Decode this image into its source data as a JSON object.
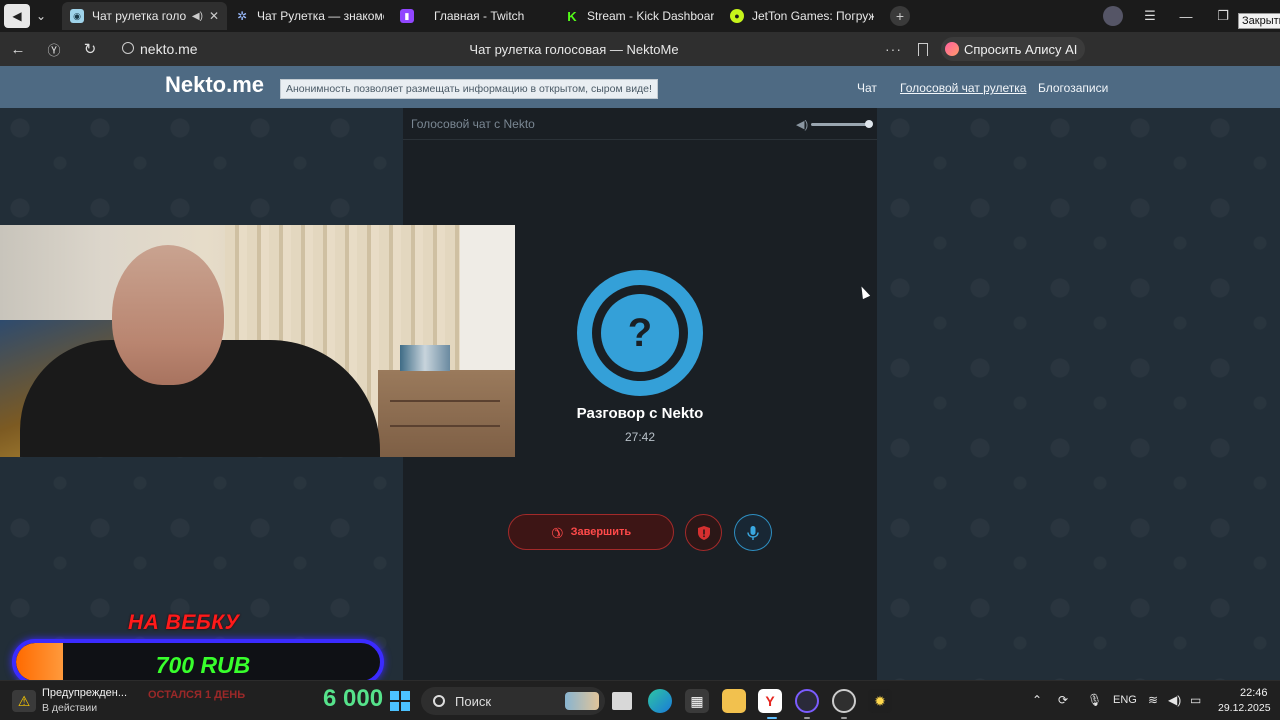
{
  "browser": {
    "tabs": [
      {
        "title": "Чат рулетка голосов",
        "active": true,
        "favicon": "nekto-icon"
      },
      {
        "title": "Чат Рулетка — знакомств",
        "active": false,
        "favicon": "gear-icon"
      },
      {
        "title": "Главная - Twitch",
        "active": false,
        "favicon": "twitch-icon"
      },
      {
        "title": "Stream - Kick Dashboard",
        "active": false,
        "favicon": "kick-icon"
      },
      {
        "title": "JetTon Games: Погружен",
        "active": false,
        "favicon": "jetton-icon"
      }
    ],
    "close_tooltip": "Закрыть",
    "address": {
      "host": "nekto.me",
      "page_title": "Чат рулетка голосовая — NektoMe"
    },
    "alice_label": "Спросить Алису AI"
  },
  "site": {
    "logo": "Nekto.me",
    "tagline": "Анонимность позволяет размещать информацию в открытом, сыром виде!",
    "nav": [
      {
        "label": "Чат",
        "active": false
      },
      {
        "label": "Голосовой чат рулетка",
        "active": true
      },
      {
        "label": "Блогозаписи",
        "active": false
      }
    ]
  },
  "chat": {
    "header_title": "Голосовой чат с Nekto",
    "avatar_symbol": "?",
    "peer_label": "Разговор с Nekto",
    "timer": "27:42",
    "end_button_label": "Завершить",
    "volume_level": 1.0
  },
  "overlay": {
    "donation_title": "НА ВЕБКУ",
    "donation_amount": "700 RUB",
    "donation_progress": 0.13,
    "donation_subtitle": "ОСТАЛСЯ 1 ДЕНЬ",
    "counter": "6 000"
  },
  "taskbar": {
    "warning_title": "Предупрежден...",
    "warning_status": "В действии",
    "search_placeholder": "Поиск",
    "language": "ENG",
    "time": "22:46",
    "date": "29.12.2025"
  },
  "colors": {
    "accent_blue": "#34a0d8",
    "danger_red": "#ff4a4a",
    "header_bg": "#4e6a83",
    "counter_green": "#56e28b"
  }
}
